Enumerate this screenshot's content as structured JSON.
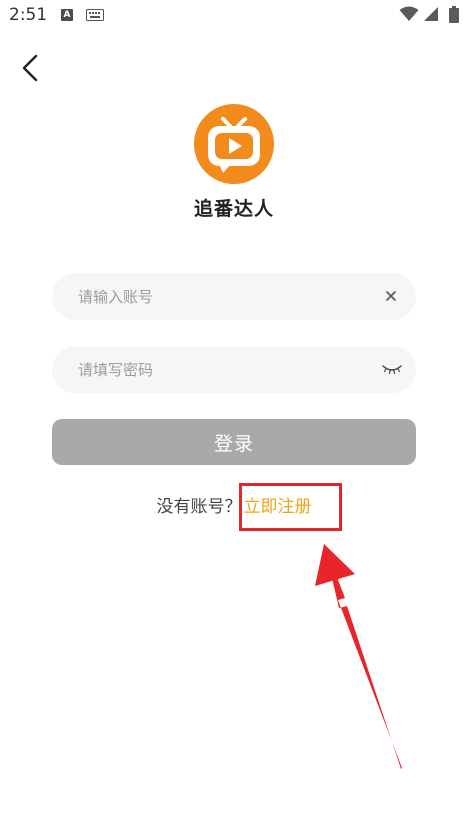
{
  "status_bar": {
    "time": "2:51",
    "notification_letter": "A"
  },
  "header": {
    "back_icon": "chevron-left-icon"
  },
  "app": {
    "logo_icon": "tv-play-logo-icon",
    "name": "追番达人",
    "brand_color": "#f28a1c"
  },
  "login_form": {
    "account_placeholder": "请输入账号",
    "account_value": "",
    "password_placeholder": "请填写密码",
    "password_value": "",
    "clear_icon": "close-icon",
    "visibility_icon": "eye-closed-icon",
    "login_label": "登录",
    "login_button_color": "#a9a9a9"
  },
  "register": {
    "prompt": "没有账号？",
    "link_label": "立即注册",
    "link_color": "#f2a514"
  },
  "annotation": {
    "color": "#e8252a"
  }
}
